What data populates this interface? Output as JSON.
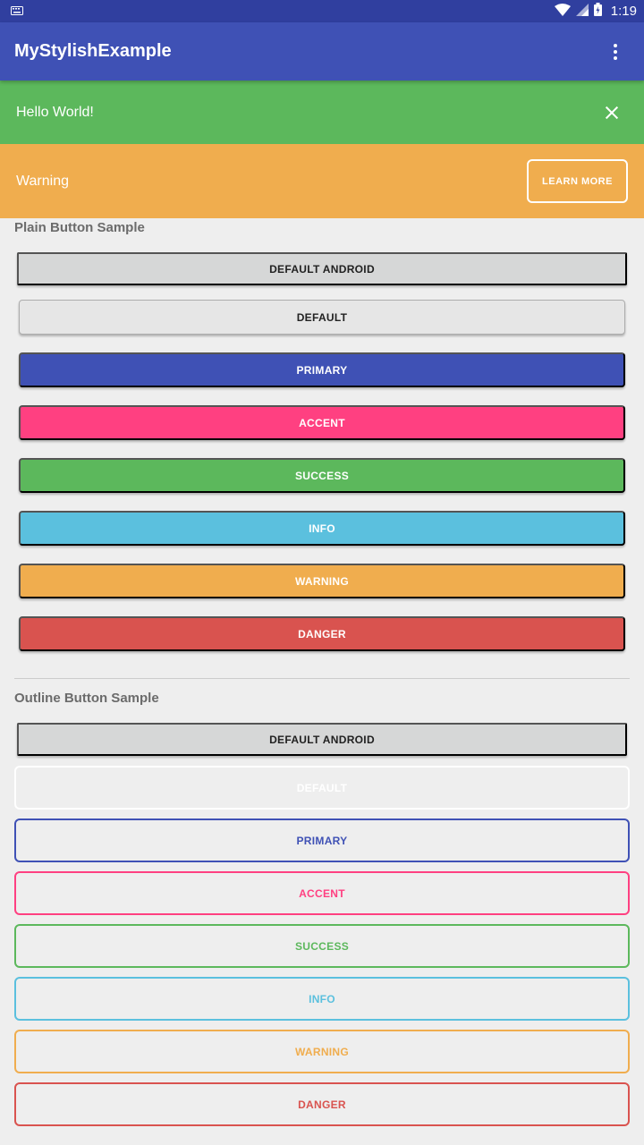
{
  "status_bar": {
    "time": "1:19"
  },
  "app_bar": {
    "title": "MyStylishExample"
  },
  "success_bar": {
    "message": "Hello World!"
  },
  "warning_bar": {
    "message": "Warning",
    "action_label": "LEARN MORE"
  },
  "plain_section": {
    "title": "Plain Button Sample",
    "buttons": [
      {
        "label": "DEFAULT ANDROID"
      },
      {
        "label": "DEFAULT"
      },
      {
        "label": "PRIMARY",
        "color": "#3f51b5"
      },
      {
        "label": "ACCENT",
        "color": "#ff4081"
      },
      {
        "label": "SUCCESS",
        "color": "#5cb85c"
      },
      {
        "label": "INFO",
        "color": "#5bc0de"
      },
      {
        "label": "WARNING",
        "color": "#f0ad4e"
      },
      {
        "label": "DANGER",
        "color": "#d9534f"
      }
    ]
  },
  "outline_section": {
    "title": "Outline Button Sample",
    "buttons": [
      {
        "label": "DEFAULT ANDROID"
      },
      {
        "label": "DEFAULT",
        "color": "#ffffff"
      },
      {
        "label": "PRIMARY",
        "color": "#3f51b5"
      },
      {
        "label": "ACCENT",
        "color": "#ff4081"
      },
      {
        "label": "SUCCESS",
        "color": "#5cb85c"
      },
      {
        "label": "INFO",
        "color": "#5bc0de"
      },
      {
        "label": "WARNING",
        "color": "#f0ad4e"
      },
      {
        "label": "DANGER",
        "color": "#d9534f"
      }
    ]
  }
}
